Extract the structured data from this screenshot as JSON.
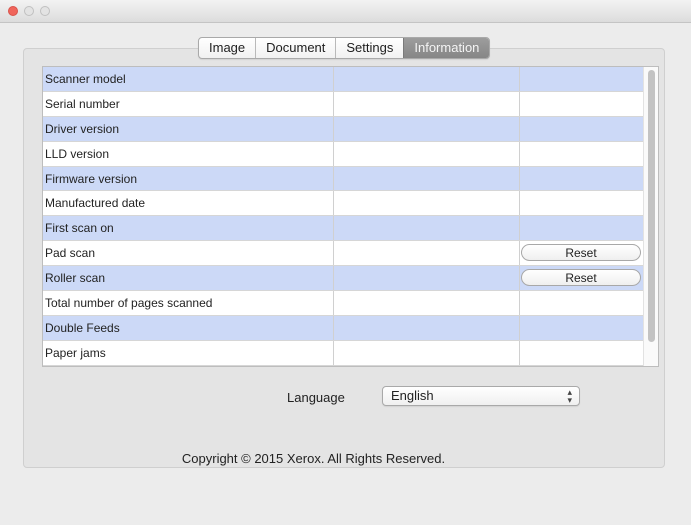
{
  "tabs": [
    {
      "label": "Image"
    },
    {
      "label": "Document"
    },
    {
      "label": "Settings"
    },
    {
      "label": "Information"
    }
  ],
  "rows": [
    {
      "label": "Scanner model",
      "reset": ""
    },
    {
      "label": "Serial number",
      "reset": ""
    },
    {
      "label": "Driver version",
      "reset": ""
    },
    {
      "label": "LLD version",
      "reset": ""
    },
    {
      "label": "Firmware version",
      "reset": ""
    },
    {
      "label": "Manufactured date",
      "reset": ""
    },
    {
      "label": "First scan on",
      "reset": ""
    },
    {
      "label": "Pad scan",
      "reset": "Reset"
    },
    {
      "label": "Roller scan",
      "reset": "Reset"
    },
    {
      "label": "Total number of pages scanned",
      "reset": ""
    },
    {
      "label": "Double Feeds",
      "reset": ""
    },
    {
      "label": "Paper jams",
      "reset": ""
    }
  ],
  "language": {
    "label": "Language",
    "value": "English"
  },
  "copyright": "Copyright © 2015 Xerox. All Rights Reserved.",
  "colors": {
    "row_alt": "#ccd9f7",
    "tab_active": "#8f8f8f",
    "close_button": "#f0655b"
  },
  "icons": {
    "close": "close-icon",
    "minimize": "minimize-icon",
    "zoom": "zoom-icon",
    "select": "up-down-arrows-icon"
  }
}
